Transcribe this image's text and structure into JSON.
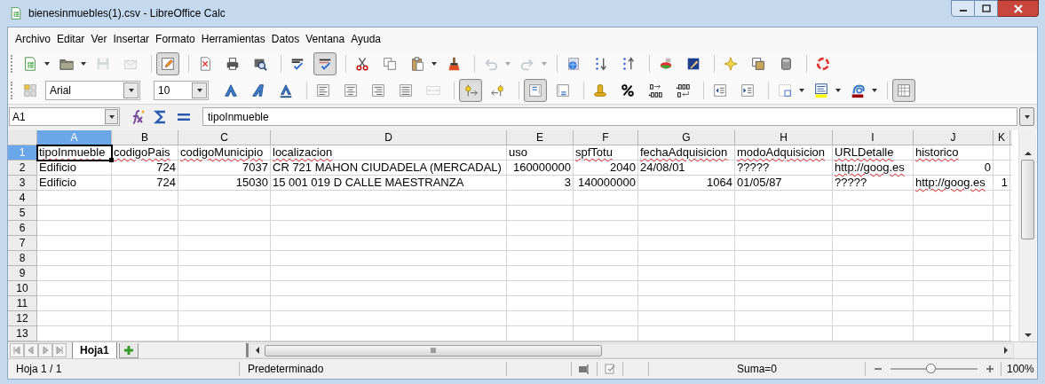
{
  "window": {
    "title": "bienesinmuebles(1).csv - LibreOffice Calc"
  },
  "menu": [
    "Archivo",
    "Editar",
    "Ver",
    "Insertar",
    "Formato",
    "Herramientas",
    "Datos",
    "Ventana",
    "Ayuda"
  ],
  "toolbar_standard": {
    "groups": [
      {
        "tools": [
          {
            "kind": "dropdown",
            "pressed": false,
            "disabled": false
          },
          {
            "kind": "dropdown",
            "pressed": false,
            "disabled": false
          },
          {
            "kind": "button",
            "pressed": false,
            "disabled": true
          },
          {
            "kind": "button",
            "pressed": false,
            "disabled": true
          }
        ]
      },
      {
        "tools": [
          {
            "kind": "button",
            "pressed": true,
            "disabled": false
          }
        ]
      },
      {
        "tools": [
          {
            "kind": "button",
            "pressed": false,
            "disabled": false
          },
          {
            "kind": "button",
            "pressed": false,
            "disabled": false
          },
          {
            "kind": "button",
            "pressed": false,
            "disabled": false
          }
        ]
      },
      {
        "tools": [
          {
            "kind": "button",
            "pressed": false,
            "disabled": false
          },
          {
            "kind": "button",
            "pressed": true,
            "disabled": false
          }
        ]
      },
      {
        "tools": [
          {
            "kind": "button",
            "pressed": false,
            "disabled": false
          },
          {
            "kind": "button",
            "pressed": false,
            "disabled": false
          },
          {
            "kind": "dropdown",
            "pressed": false,
            "disabled": false
          },
          {
            "kind": "button",
            "pressed": false,
            "disabled": false
          }
        ]
      },
      {
        "tools": [
          {
            "kind": "dropdown",
            "pressed": false,
            "disabled": true
          },
          {
            "kind": "dropdown",
            "pressed": false,
            "disabled": true
          }
        ]
      },
      {
        "tools": [
          {
            "kind": "button",
            "pressed": false,
            "disabled": false
          },
          {
            "kind": "button",
            "pressed": false,
            "disabled": false
          },
          {
            "kind": "button",
            "pressed": false,
            "disabled": false
          }
        ]
      },
      {
        "tools": [
          {
            "kind": "button",
            "pressed": false,
            "disabled": false
          },
          {
            "kind": "button",
            "pressed": false,
            "disabled": false
          }
        ]
      },
      {
        "tools": [
          {
            "kind": "button",
            "pressed": false,
            "disabled": false
          },
          {
            "kind": "button",
            "pressed": false,
            "disabled": false
          },
          {
            "kind": "button",
            "pressed": false,
            "disabled": false
          }
        ]
      },
      {
        "tools": [
          {
            "kind": "button",
            "pressed": false,
            "disabled": false
          }
        ]
      }
    ]
  },
  "toolbar_formatting": {
    "font_name": "Arial",
    "font_size": "10",
    "groups": [
      {
        "tools": [
          {
            "kind": "button",
            "pressed": false,
            "disabled": false
          },
          {
            "kind": "button",
            "pressed": false,
            "disabled": false
          },
          {
            "kind": "button",
            "pressed": false,
            "disabled": false
          }
        ]
      },
      {
        "tools": [
          {
            "kind": "button",
            "pressed": false,
            "disabled": false
          },
          {
            "kind": "button",
            "pressed": false,
            "disabled": false
          },
          {
            "kind": "button",
            "pressed": false,
            "disabled": false
          },
          {
            "kind": "button",
            "pressed": false,
            "disabled": false
          },
          {
            "kind": "button",
            "pressed": false,
            "disabled": true
          }
        ]
      },
      {
        "tools": [
          {
            "kind": "button",
            "pressed": true,
            "disabled": false
          },
          {
            "kind": "button",
            "pressed": false,
            "disabled": false
          }
        ]
      },
      {
        "tools": [
          {
            "kind": "button",
            "pressed": true,
            "disabled": false
          },
          {
            "kind": "button",
            "pressed": false,
            "disabled": false
          }
        ]
      },
      {
        "tools": [
          {
            "kind": "button",
            "pressed": false,
            "disabled": false
          },
          {
            "kind": "button",
            "pressed": false,
            "disabled": false
          },
          {
            "kind": "button",
            "pressed": false,
            "disabled": false
          },
          {
            "kind": "button",
            "pressed": false,
            "disabled": false
          }
        ]
      },
      {
        "tools": [
          {
            "kind": "button",
            "pressed": false,
            "disabled": false
          },
          {
            "kind": "button",
            "pressed": false,
            "disabled": false
          }
        ]
      },
      {
        "tools": [
          {
            "kind": "dropdown",
            "pressed": false,
            "disabled": false
          },
          {
            "kind": "dropdown",
            "pressed": false,
            "disabled": false
          },
          {
            "kind": "dropdown",
            "pressed": false,
            "disabled": false
          }
        ]
      },
      {
        "tools": [
          {
            "kind": "button",
            "pressed": true,
            "disabled": false
          }
        ]
      }
    ]
  },
  "formula_bar": {
    "name_box": "A1",
    "content": "tipoInmueble"
  },
  "sheet": {
    "columns": [
      {
        "label": "A",
        "selected": true
      },
      {
        "label": "B",
        "selected": false
      },
      {
        "label": "C",
        "selected": false
      },
      {
        "label": "D",
        "selected": false
      },
      {
        "label": "E",
        "selected": false
      },
      {
        "label": "F",
        "selected": false
      },
      {
        "label": "G",
        "selected": false
      },
      {
        "label": "H",
        "selected": false
      },
      {
        "label": "I",
        "selected": false
      },
      {
        "label": "J",
        "selected": false
      },
      {
        "label": "K",
        "selected": false
      }
    ],
    "rows": [
      {
        "number": "1",
        "selected": true,
        "cells": [
          {
            "text": "tipoInmueble",
            "kind": "text",
            "misspelled": true,
            "selected": true
          },
          {
            "text": "codigoPais",
            "kind": "text",
            "misspelled": true,
            "selected": false
          },
          {
            "text": "codigoMunicipio",
            "kind": "text",
            "misspelled": true,
            "selected": false
          },
          {
            "text": "localizacion",
            "kind": "text",
            "misspelled": true,
            "selected": false
          },
          {
            "text": "uso",
            "kind": "text",
            "misspelled": false,
            "selected": false
          },
          {
            "text": "spfTotu",
            "kind": "text",
            "misspelled": true,
            "selected": false
          },
          {
            "text": "fechaAdquisicion",
            "kind": "text",
            "misspelled": true,
            "selected": false
          },
          {
            "text": "modoAdquisicion",
            "kind": "text",
            "misspelled": true,
            "selected": false
          },
          {
            "text": "URLDetalle",
            "kind": "text",
            "misspelled": true,
            "selected": false
          },
          {
            "text": "historico",
            "kind": "text",
            "misspelled": true,
            "selected": false
          },
          null
        ]
      },
      {
        "number": "2",
        "selected": false,
        "cells": [
          {
            "text": "Edificio",
            "kind": "text",
            "misspelled": false,
            "selected": false
          },
          {
            "text": "724",
            "kind": "number",
            "misspelled": false,
            "selected": false
          },
          {
            "text": "7037",
            "kind": "number",
            "misspelled": false,
            "selected": false
          },
          {
            "text": "CR 721 MAHON CIUDADELA (MERCADAL)",
            "kind": "text",
            "misspelled": false,
            "selected": false
          },
          {
            "text": "160000000",
            "kind": "number",
            "misspelled": false,
            "selected": false
          },
          {
            "text": "2040",
            "kind": "number",
            "misspelled": false,
            "selected": false
          },
          {
            "text": "24/08/01",
            "kind": "text",
            "misspelled": false,
            "selected": false
          },
          {
            "text": "?????",
            "kind": "text",
            "misspelled": false,
            "selected": false
          },
          {
            "text": "http://goog.es",
            "kind": "text",
            "misspelled": true,
            "selected": false
          },
          {
            "text": "0",
            "kind": "number",
            "misspelled": false,
            "selected": false
          },
          null
        ]
      },
      {
        "number": "3",
        "selected": false,
        "cells": [
          {
            "text": "Edificio",
            "kind": "text",
            "misspelled": false,
            "selected": false
          },
          {
            "text": "724",
            "kind": "number",
            "misspelled": false,
            "selected": false
          },
          {
            "text": "15030",
            "kind": "number",
            "misspelled": false,
            "selected": false
          },
          {
            "text": "15 001 019 D CALLE MAESTRANZA",
            "kind": "text",
            "misspelled": false,
            "selected": false
          },
          {
            "text": "3",
            "kind": "number",
            "misspelled": false,
            "selected": false
          },
          {
            "text": "140000000",
            "kind": "number",
            "misspelled": false,
            "selected": false
          },
          {
            "text": "1064",
            "kind": "number",
            "misspelled": false,
            "selected": false
          },
          {
            "text": "01/05/87",
            "kind": "text",
            "misspelled": false,
            "selected": false
          },
          {
            "text": "?????",
            "kind": "text",
            "misspelled": false,
            "selected": false
          },
          {
            "text": "http://goog.es",
            "kind": "text",
            "misspelled": true,
            "selected": false
          },
          {
            "text": "1",
            "kind": "number",
            "misspelled": false,
            "selected": false
          }
        ]
      },
      {
        "number": "4",
        "selected": false
      },
      {
        "number": "5",
        "selected": false
      },
      {
        "number": "6",
        "selected": false
      },
      {
        "number": "7",
        "selected": false
      },
      {
        "number": "8",
        "selected": false
      },
      {
        "number": "9",
        "selected": false
      },
      {
        "number": "10",
        "selected": false
      },
      {
        "number": "11",
        "selected": false
      },
      {
        "number": "12",
        "selected": false
      },
      {
        "number": "13",
        "selected": false
      }
    ]
  },
  "sheet_tabs": [
    {
      "label": "Hoja1",
      "selected": true
    }
  ],
  "status_bar": {
    "sheet": "Hoja 1 / 1",
    "page_style": "Predeterminado",
    "sum": "Suma=0",
    "zoom": {
      "level": 0.46,
      "reading": "100%"
    }
  }
}
